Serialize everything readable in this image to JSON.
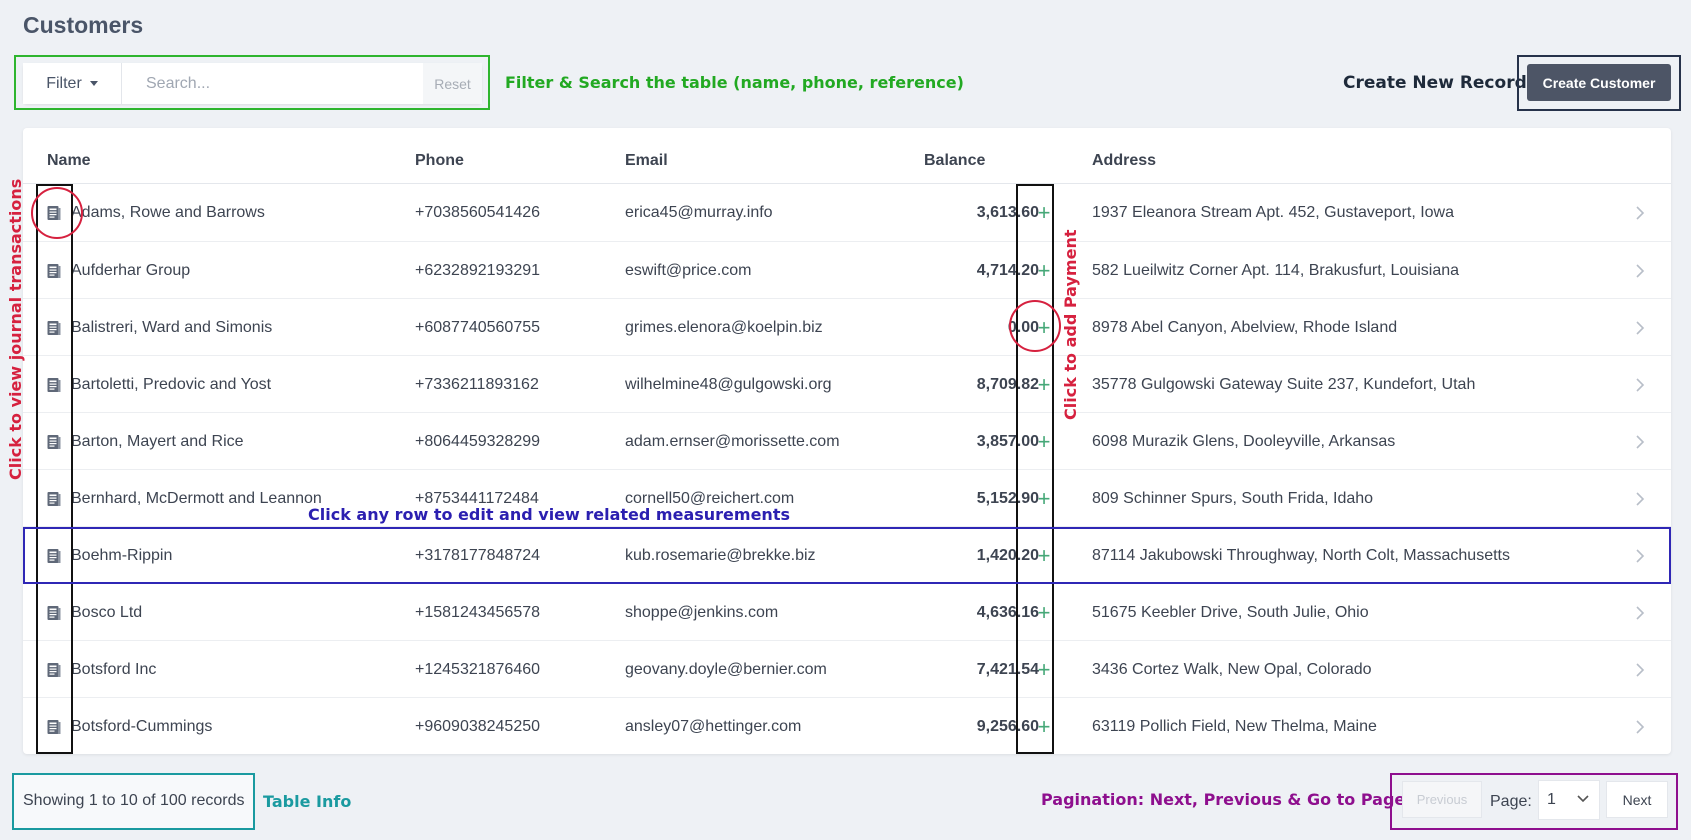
{
  "page": {
    "title": "Customers"
  },
  "filter": {
    "filter_label": "Filter",
    "search_placeholder": "Search...",
    "reset_label": "Reset"
  },
  "toolbar": {
    "create_button_label": "Create Customer"
  },
  "annotations": {
    "filter_search": "Filter & Search the table (name, phone, reference)",
    "create_new": "Create New Record",
    "journal": "Click to view journal transactions",
    "payment": "Click to add Payment",
    "row_edit": "Click any row to edit and view related measurements",
    "table_info": "Table Info",
    "pagination": "Pagination: Next, Previous & Go to Page"
  },
  "table": {
    "columns": [
      "Name",
      "Phone",
      "Email",
      "Balance",
      "Address"
    ],
    "rows": [
      {
        "name": "Adams, Rowe and Barrows",
        "phone": "+7038560541426",
        "email": "erica45@murray.info",
        "balance": "3,613.60",
        "address": "1937 Eleanora Stream Apt. 452, Gustaveport, Iowa"
      },
      {
        "name": "Aufderhar Group",
        "phone": "+6232892193291",
        "email": "eswift@price.com",
        "balance": "4,714.20",
        "address": "582 Lueilwitz Corner Apt. 114, Brakusfurt, Louisiana"
      },
      {
        "name": "Balistreri, Ward and Simonis",
        "phone": "+6087740560755",
        "email": "grimes.elenora@koelpin.biz",
        "balance": "0.00",
        "address": "8978 Abel Canyon, Abelview, Rhode Island"
      },
      {
        "name": "Bartoletti, Predovic and Yost",
        "phone": "+7336211893162",
        "email": "wilhelmine48@gulgowski.org",
        "balance": "8,709.82",
        "address": "35778 Gulgowski Gateway Suite 237, Kundefort, Utah"
      },
      {
        "name": "Barton, Mayert and Rice",
        "phone": "+8064459328299",
        "email": "adam.ernser@morissette.com",
        "balance": "3,857.00",
        "address": "6098 Murazik Glens, Dooleyville, Arkansas"
      },
      {
        "name": "Bernhard, McDermott and Leannon",
        "phone": "+8753441172484",
        "email": "cornell50@reichert.com",
        "balance": "5,152.90",
        "address": "809 Schinner Spurs, South Frida, Idaho"
      },
      {
        "name": "Boehm-Rippin",
        "phone": "+3178177848724",
        "email": "kub.rosemarie@brekke.biz",
        "balance": "1,420.20",
        "address": "87114 Jakubowski Throughway, North Colt, Massachusetts"
      },
      {
        "name": "Bosco Ltd",
        "phone": "+1581243456578",
        "email": "shoppe@jenkins.com",
        "balance": "4,636.16",
        "address": "51675 Keebler Drive, South Julie, Ohio"
      },
      {
        "name": "Botsford Inc",
        "phone": "+1245321876460",
        "email": "geovany.doyle@bernier.com",
        "balance": "7,421.54",
        "address": "3436 Cortez Walk, New Opal, Colorado"
      },
      {
        "name": "Botsford-Cummings",
        "phone": "+9609038245250",
        "email": "ansley07@hettinger.com",
        "balance": "9,256.60",
        "address": "63119 Pollich Field, New Thelma, Maine"
      }
    ]
  },
  "footer": {
    "info": "Showing 1 to 10 of 100 records",
    "pagination": {
      "previous_label": "Previous",
      "page_label": "Page:",
      "page_value": "1",
      "next_label": "Next"
    }
  },
  "icons": {
    "journal": "journal-icon",
    "add_payment": "plus-icon",
    "row_nav": "chevron-right-icon"
  },
  "colors": {
    "annotation_green": "#22a922",
    "annotation_red": "#d6213f",
    "annotation_blue": "#2b1fb0",
    "annotation_teal": "#1a9aa0",
    "annotation_purple": "#8e0f8e",
    "plus_green": "#46a878",
    "button_dark": "#4d5566"
  }
}
